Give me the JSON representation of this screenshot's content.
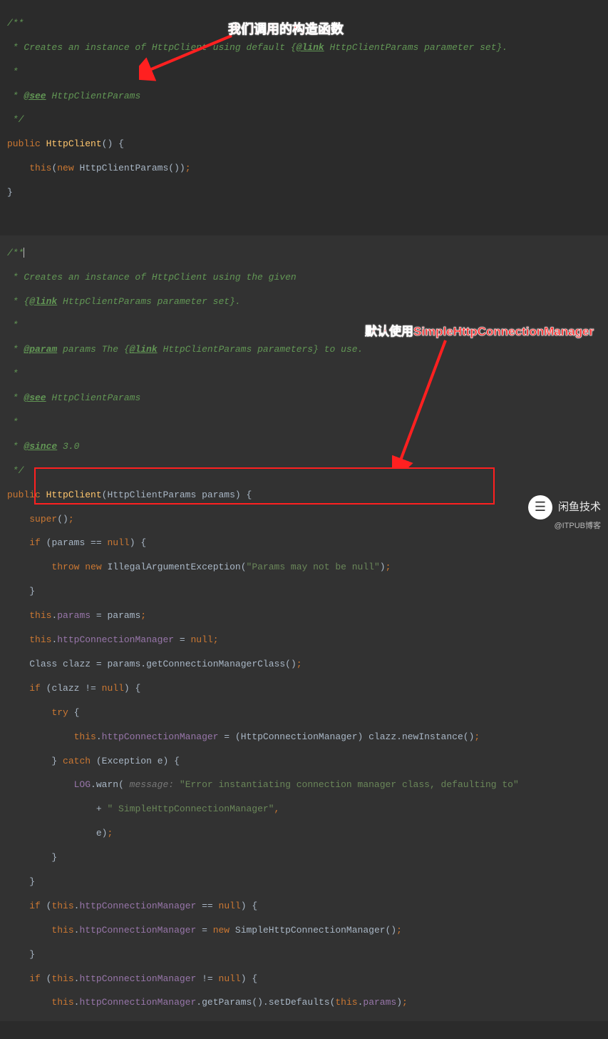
{
  "annotation1": "我们调用的构造函数",
  "annotation2": "默认使用SimpleHttpConnectionManager",
  "watermark": {
    "name": "闲鱼技术",
    "sub": "@ITPUB博客"
  },
  "c": {
    "jd1_open": "/**",
    "jd1_l1_a": " * Creates an instance of HttpClient using default {",
    "jd1_l1_link": "@link",
    "jd1_l1_b": " HttpClientParams parameter set}.",
    "jd_star": " *",
    "jd_see": "@see",
    "jd_see_txt": " HttpClientParams",
    "jd_close": " */",
    "kw_public": "public",
    "id_HttpClient": "HttpClient",
    "lparen": "(",
    "rparen": ")",
    "lbrace": "{",
    "rbrace": "}",
    "kw_this": "this",
    "kw_new": "new",
    "id_HttpClientParams": "HttpClientParams",
    "semicolon": ";",
    "empty_call": "()",
    "jd2_open": "/**",
    "jd2_l1": " * Creates an instance of HttpClient using the given ",
    "jd2_l2_a": " * {",
    "jd2_l2_link": "@link",
    "jd2_l2_b": " HttpClientParams parameter set}.",
    "jd_param": "@param",
    "jd_param_txt_a": " params The {",
    "jd_param_link": "@link",
    "jd_param_txt_b": " HttpClientParams parameters} to use.",
    "jd_since": "@since",
    "jd_since_txt": " 3.0",
    "sig2_params": "HttpClientParams params",
    "kw_super": "super",
    "kw_if": "if",
    "cond_params_null": "params == ",
    "kw_null": "null",
    "kw_throw": "throw",
    "id_IAE": "IllegalArgumentException",
    "str_params_null": "\"Params may not be null\"",
    "f_params": "params",
    "eq": " = ",
    "f_httpConn": "httpConnectionManager",
    "cls_Class": "Class",
    "id_clazz": "clazz",
    "call_getCMC": "getConnectionManagerClass",
    "cond_clazz_ne": "clazz != ",
    "kw_try": "try",
    "cast_type": "(HttpConnectionManager) ",
    "call_newInstance": "newInstance",
    "kw_catch": "catch",
    "catch_sig": "(Exception e)",
    "id_LOG": "LOG",
    "call_warn": "warn",
    "hint_message": " message: ",
    "str_warn1": "\"Error instantiating connection manager class, defaulting to\"",
    "plus": "+ ",
    "str_warn2": "\" SimpleHttpConnectionManager\"",
    "arg_e": "e",
    "cond_conn_eq_null": " == ",
    "id_SimpleHCM": "SimpleHttpConnectionManager",
    "cond_conn_ne_null": " != ",
    "call_getParams": "getParams",
    "call_setDefaults": "setDefaults",
    "dot": "."
  }
}
